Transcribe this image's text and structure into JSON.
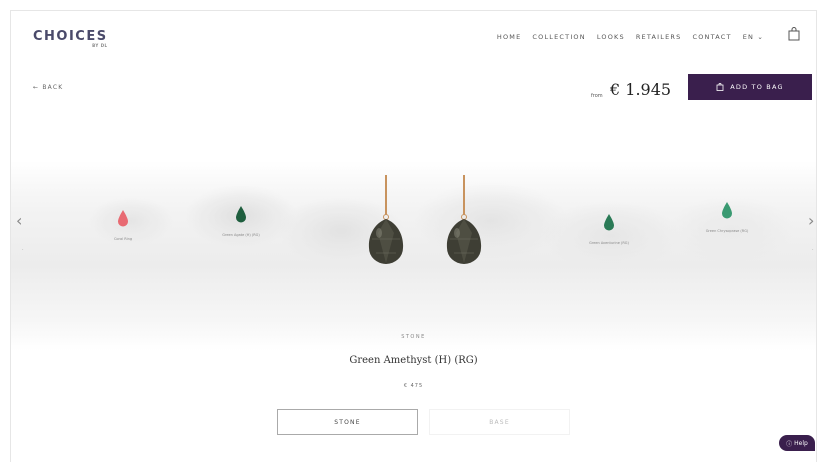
{
  "header": {
    "logo": "CHOICES",
    "logo_sub": "BY DL",
    "nav": [
      "HOME",
      "COLLECTION",
      "LOOKS",
      "RETAILERS",
      "CONTACT",
      "EN ⌄"
    ],
    "bag_icon": "shopping-bag-icon"
  },
  "product_bar": {
    "back_label": "← BACK",
    "price_prefix": "from",
    "price": "€ 1.945",
    "add_to_bag_label": "ADD TO BAG"
  },
  "stones": [
    {
      "label": "Coral Ring",
      "color": "#e86a72"
    },
    {
      "label": "Green Agate (H) (RG)",
      "color": "#1e5e3e"
    },
    {
      "label": "Green Amethyst (H) (RG)",
      "color": "#4a4a3e"
    },
    {
      "label": "Green Aventurine (RG)",
      "color": "#2a7a56"
    },
    {
      "label": "Green Chrysoprase (RG)",
      "color": "#3a9a72"
    }
  ],
  "selected": {
    "category": "STONE",
    "name": "Green Amethyst (H) (RG)",
    "price": "€ 475"
  },
  "tabs": {
    "stone": "STONE",
    "base": "BASE"
  },
  "help": {
    "label": "Help",
    "icon": "question-icon"
  },
  "colors": {
    "accent": "#3a1f4d",
    "gold": "#c8935e",
    "stone_dark": "#3e3e34"
  }
}
